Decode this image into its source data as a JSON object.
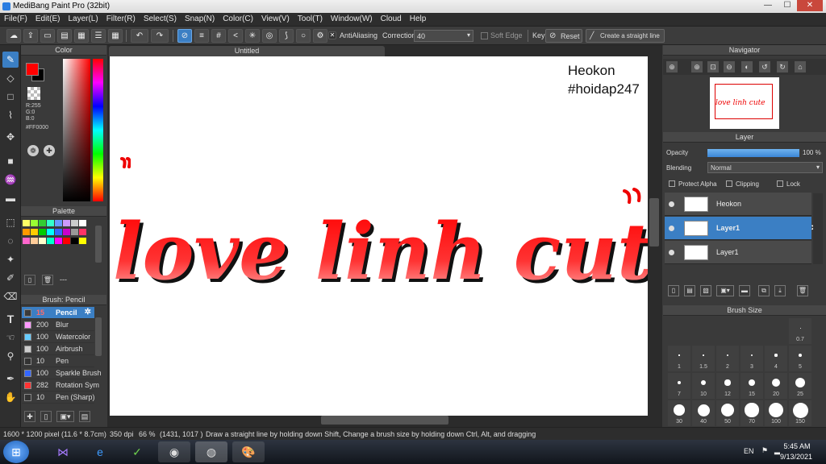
{
  "window": {
    "title": "MediBang Paint Pro (32bit)",
    "minimize": "—",
    "maximize": "☐",
    "close": "✕"
  },
  "menu": [
    "File(F)",
    "Edit(E)",
    "Layer(L)",
    "Filter(R)",
    "Select(S)",
    "Snap(N)",
    "Color(C)",
    "View(V)",
    "Tool(T)",
    "Window(W)",
    "Cloud",
    "Help"
  ],
  "toolbar": {
    "antialiasing_label": "AntiAliasing",
    "correction_label": "Correction",
    "correction_value": "40",
    "soft_edge_label": "Soft Edge",
    "key_label": "Key",
    "reset_label": "Reset",
    "straight_line_label": "Create a straight line"
  },
  "color_panel": {
    "title": "Color",
    "r": "R:255",
    "g": "G:0",
    "b": "B:0",
    "hex": "#FF0000",
    "primary": "#ff0000",
    "secondary": "#000000"
  },
  "palette_panel": {
    "title": "Palette",
    "dash": "---",
    "colors": [
      "#ffff66",
      "#99ff33",
      "#33cc33",
      "#33ffcc",
      "#6699ff",
      "#cc99ff",
      "#cccccc",
      "#ffffff",
      "#ff9900",
      "#ffcc00",
      "#00cc00",
      "#00ffff",
      "#3366ff",
      "#cc00cc",
      "#999999",
      "#ff3366",
      "#ff66cc",
      "#ffcc99",
      "#ffffcc",
      "#00ffcc",
      "#ff00ff",
      "#ff0000",
      "#000000",
      "#ffff00"
    ]
  },
  "brush_panel": {
    "title": "Brush: Pencil",
    "brushes": [
      {
        "size": "15",
        "name": "Pencil",
        "color": "#3a3a3a"
      },
      {
        "size": "200",
        "name": "Blur",
        "color": "#ff99ff"
      },
      {
        "size": "100",
        "name": "Watercolor",
        "color": "#66ccff"
      },
      {
        "size": "100",
        "name": "Airbrush",
        "color": "#cccccc"
      },
      {
        "size": "10",
        "name": "Pen",
        "color": "#333333"
      },
      {
        "size": "100",
        "name": "Sparkle Brush",
        "color": "#3366ff"
      },
      {
        "size": "282",
        "name": "Rotation Sym",
        "color": "#ff3333"
      },
      {
        "size": "10",
        "name": "Pen (Sharp)",
        "color": "#333333"
      }
    ]
  },
  "canvas": {
    "tab_title": "Untitled",
    "watermark_1": "Heokon",
    "watermark_2": "#hoidap247",
    "artwork": "love linh cute"
  },
  "navigator": {
    "title": "Navigator",
    "thumb_text": "love linh cute"
  },
  "layer_panel": {
    "title": "Layer",
    "opacity_label": "Opacity",
    "opacity_value": "100 %",
    "opacity": 1.0,
    "blending_label": "Blending",
    "blending_value": "Normal",
    "protect_alpha": "Protect Alpha",
    "clipping": "Clipping",
    "lock": "Lock",
    "layers": [
      {
        "name": "Heokon",
        "selected": false
      },
      {
        "name": "Layer1",
        "selected": true
      },
      {
        "name": "Layer1",
        "selected": false
      }
    ]
  },
  "brush_size": {
    "title": "Brush Size",
    "sizes": [
      "0.7",
      "1",
      "1.5",
      "2",
      "3",
      "4",
      "5",
      "7",
      "10",
      "12",
      "15",
      "20",
      "25",
      "30",
      "40",
      "50",
      "70",
      "100",
      "150"
    ]
  },
  "status": {
    "dimensions": "1600 * 1200 pixel",
    "physical": "(11.6 * 8.7cm)",
    "dpi": "350 dpi",
    "zoom": "66 %",
    "coords": "(1431, 1017 )",
    "hint": "Draw a straight line by holding down Shift, Change a brush size by holding down Ctrl, Alt, and dragging"
  },
  "taskbar": {
    "lang": "EN",
    "time": "5:45 AM",
    "date": "9/13/2021"
  }
}
